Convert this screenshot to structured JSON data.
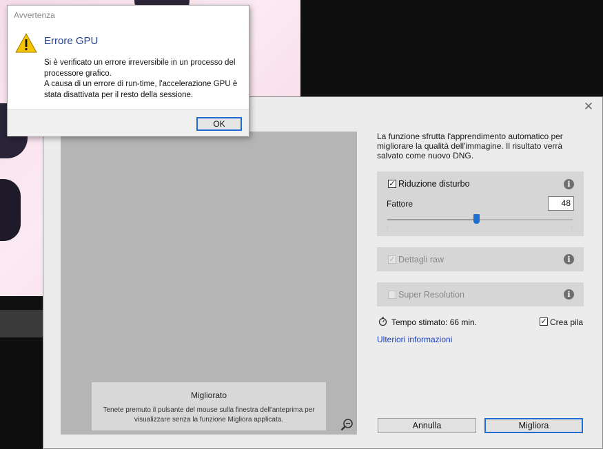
{
  "error_dialog": {
    "window_title": "Avvertenza",
    "heading": "Errore GPU",
    "message_line1": "Si è verificato un errore irreversibile in un processo del processore grafico.",
    "message_line2": "A causa di un errore di run-time, l'accelerazione GPU è stata disattivata per il resto della sessione.",
    "ok_label": "OK",
    "icon": "warning-icon"
  },
  "enhance_dialog": {
    "close_glyph": "✕",
    "info_text": "La funzione sfrutta l'apprendimento automatico per migliorare la qualità dell'immagine. Il risultato verrà salvato come nuovo DNG.",
    "preview": {
      "caption_title": "Migliorato",
      "caption_text": "Tenete premuto il pulsante del mouse sulla finestra dell'anteprima per visualizzare senza la funzione Migliora applicata."
    },
    "noise_reduction": {
      "label": "Riduzione disturbo",
      "checked": true,
      "factor_label": "Fattore",
      "factor_value": "48",
      "slider_fraction": 0.48
    },
    "raw_details": {
      "label": "Dettagli raw",
      "checked": true,
      "disabled": true
    },
    "super_resolution": {
      "label": "Super Resolution",
      "checked": false,
      "disabled": true
    },
    "estimated_time": "Tempo stimato: 66 min.",
    "create_stack": {
      "label": "Crea pila",
      "checked": true
    },
    "more_info_link": "Ulteriori informazioni",
    "cancel_label": "Annulla",
    "enhance_label": "Migliora"
  },
  "colors": {
    "accent": "#1f6fd1",
    "link": "#1a3fbd",
    "heading": "#1f3f8f"
  }
}
